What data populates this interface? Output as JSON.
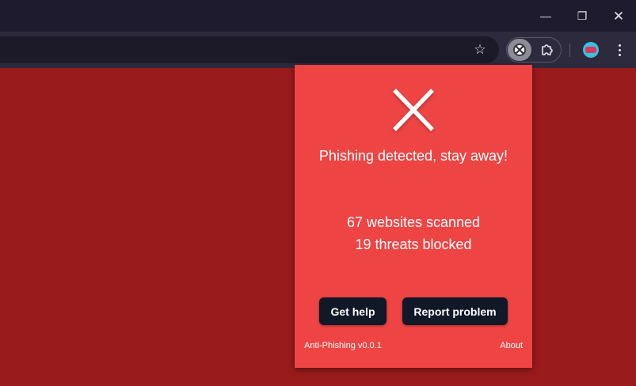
{
  "window": {
    "minimize_glyph": "—",
    "restore_glyph": "❐",
    "close_glyph": "✕"
  },
  "toolbar": {
    "bookmark_icon": "☆",
    "extension_icon": "anti-phishing-extension-icon",
    "puzzle_icon": "extensions-puzzle-icon",
    "menu_icon": "kebab-menu-icon",
    "avatar_icon": "profile-avatar-icon"
  },
  "popup": {
    "status_icon": "x-icon",
    "status_title": "Phishing detected, stay away!",
    "stats": {
      "websites_scanned": "67 websites scanned",
      "threats_blocked": "19 threats blocked"
    },
    "buttons": {
      "help": "Get help",
      "report": "Report problem"
    },
    "footer": {
      "version": "Anti-Phishing v0.0.1",
      "about": "About"
    }
  },
  "colors": {
    "page_background": "#991b1b",
    "popup_background": "#ef4444",
    "button_background": "#111827",
    "titlebar": "#1f1b2e",
    "toolbar": "#2c2a3c"
  }
}
